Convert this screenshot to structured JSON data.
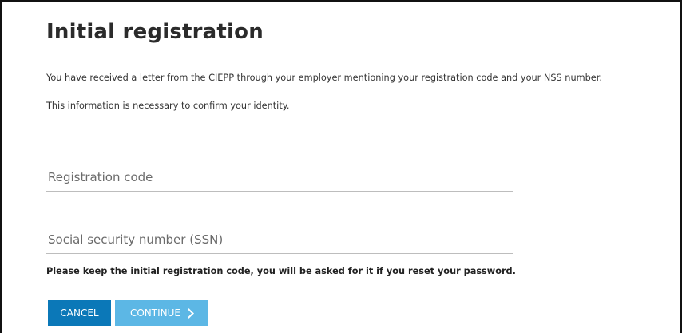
{
  "page": {
    "title": "Initial registration",
    "intro_line_1": "You have received a letter from the CIEPP through your employer mentioning your registration code and your NSS number.",
    "intro_line_2": "This information is necessary to confirm your identity."
  },
  "form": {
    "registration_code": {
      "placeholder": "Registration code",
      "value": ""
    },
    "ssn": {
      "placeholder": "Social security number (SSN)",
      "value": ""
    },
    "reminder": "Please keep the initial registration code, you will be asked for it if you reset your password."
  },
  "actions": {
    "cancel_label": "CANCEL",
    "continue_label": "CONTINUE",
    "continue_icon": "chevron-right-icon"
  },
  "colors": {
    "cancel_bg": "#0b78b8",
    "continue_bg": "#5cb7e5",
    "title_text": "#2b2b2b"
  }
}
